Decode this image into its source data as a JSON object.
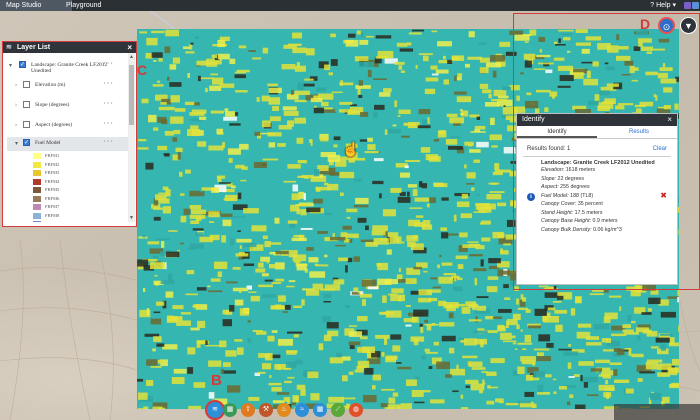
{
  "topbar": {
    "tab_active": "Map Studio",
    "tab_2": "Playground",
    "help": "Help"
  },
  "layer_list": {
    "title": "Layer List",
    "landscape": "Landscape: Granite Creek LF2012 Unedited",
    "layers": [
      "Elevation (m)",
      "Slope (degrees)",
      "Aspect (degrees)",
      "Fuel Model"
    ],
    "legend": [
      {
        "label": "FBFM1",
        "color": "#ffff8a"
      },
      {
        "label": "FBFM2",
        "color": "#f2e640"
      },
      {
        "label": "FBFM3",
        "color": "#e8c630"
      },
      {
        "label": "FBFM4",
        "color": "#b03b2b"
      },
      {
        "label": "FBFM5",
        "color": "#7a5a3a"
      },
      {
        "label": "FBFM6",
        "color": "#9a7a5a"
      },
      {
        "label": "FBFM7",
        "color": "#c08ab0"
      },
      {
        "label": "FBFM8",
        "color": "#8ab4d6"
      },
      {
        "label": "FBFM9",
        "color": "#6a8fc0"
      },
      {
        "label": "FBFM10",
        "color": "#3a6a3a"
      }
    ]
  },
  "identify": {
    "title": "Identify",
    "tab_identify": "Identify",
    "tab_results": "Results",
    "results_found": "Results found: 1",
    "clear": "Clear",
    "result_title": "Landscape: Granite Creek LF2012 Unedited",
    "attributes": [
      "Elevation: 1618 meters",
      "Slope: 22 degrees",
      "Aspect: 255 degrees",
      "Fuel Model: 188 (TL8)",
      "Canopy Cover: 35 percent",
      "Stand Height: 17.5 meters",
      "Canopy Base Height: 0.9 meters",
      "Canopy Bulk Density: 0.06 kg/m^3"
    ]
  },
  "markers": {
    "b": "B",
    "c": "C",
    "d": "D"
  },
  "toolbar_icons": [
    "layers-icon",
    "map-icon",
    "upload-icon",
    "tools-icon",
    "fire-icon",
    "water-icon",
    "grid-icon",
    "measure-icon",
    "globe-icon"
  ],
  "colors": {
    "accent": "#d43a3a",
    "dark": "#2f343a",
    "link": "#2a6fd6",
    "raster_base": "#35b6b0",
    "raster_fuel": "#e2e23a"
  }
}
